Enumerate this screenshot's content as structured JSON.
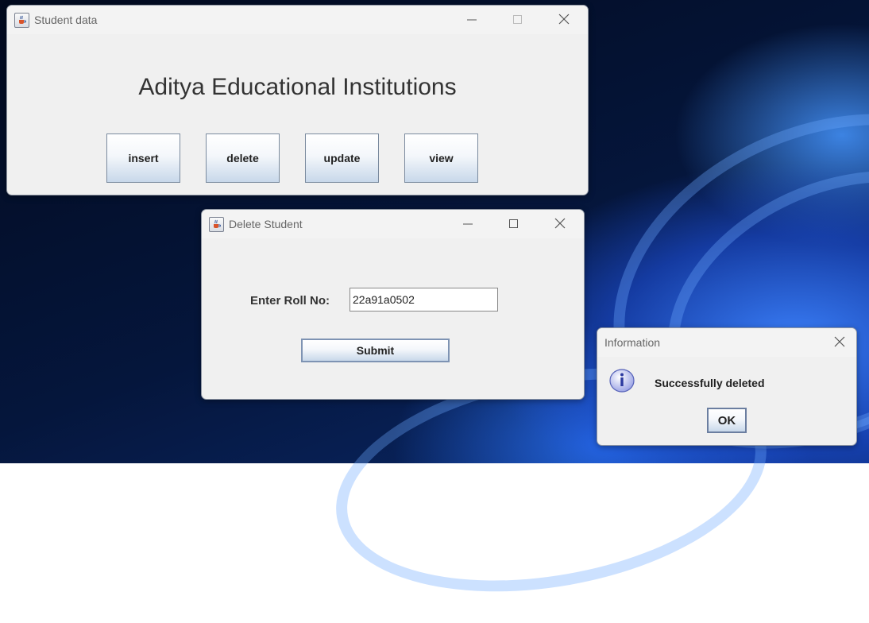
{
  "student_window": {
    "title": "Student data",
    "heading": "Aditya Educational Institutions",
    "buttons": [
      "insert",
      "delete",
      "update",
      "view"
    ]
  },
  "delete_window": {
    "title": "Delete Student",
    "roll_label": "Enter Roll No:",
    "roll_value": "22a91a0502",
    "submit_label": "Submit"
  },
  "info_dialog": {
    "title": "Information",
    "message": "Successfully deleted",
    "ok_label": "OK",
    "icon": "info-icon"
  },
  "icons": {
    "app": "java-cup-icon",
    "minimize": "minimize-icon",
    "maximize": "maximize-icon",
    "close": "close-icon"
  },
  "colors": {
    "window_bg": "#f0f0f0",
    "button_gradient_bottom": "#c8d8ea",
    "desktop_dark": "#05163c",
    "desktop_accent": "#3c82ff"
  }
}
